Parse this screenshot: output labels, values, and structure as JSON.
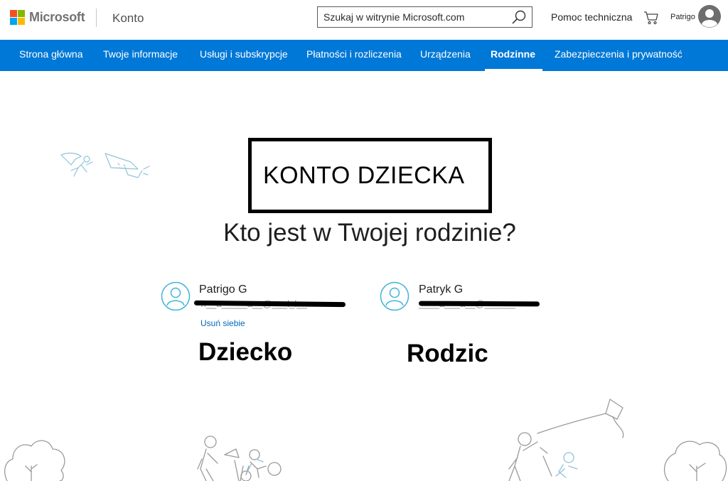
{
  "header": {
    "brand": "Microsoft",
    "section": "Konto",
    "search_placeholder": "Szukaj w witrynie Microsoft.com",
    "help": "Pomoc techniczna",
    "user_name": "Patrigo",
    "logo_colors": [
      "#f25022",
      "#7fba00",
      "#00a4ef",
      "#ffb900"
    ]
  },
  "nav": {
    "items": [
      {
        "label": "Strona główna"
      },
      {
        "label": "Twoje informacje"
      },
      {
        "label": "Usługi i subskrypcje"
      },
      {
        "label": "Płatności i rozliczenia"
      },
      {
        "label": "Urządzenia"
      },
      {
        "label": "Rodzinne",
        "active": true
      },
      {
        "label": "Zabezpieczenia i prywatność"
      }
    ],
    "background": "#0078d7"
  },
  "annotation": {
    "text": "KONTO DZIECKA"
  },
  "main": {
    "heading": "Kto jest w Twojej rodzinie?",
    "members": [
      {
        "name": "Patrigo G",
        "email": " h__a_____a__@___l_l__",
        "action": "Usuń siebie",
        "role": "Dziecko"
      },
      {
        "name": "Patryk G",
        "email": "____a___a__@______",
        "role": "Rodzic"
      }
    ]
  },
  "icons": {
    "search": "search-icon",
    "cart": "cart-icon",
    "avatar": "avatar-icon",
    "member": "person-icon"
  },
  "colors": {
    "accent": "#0078d7",
    "link": "#0067b8",
    "member_icon": "#3fb3d9"
  }
}
